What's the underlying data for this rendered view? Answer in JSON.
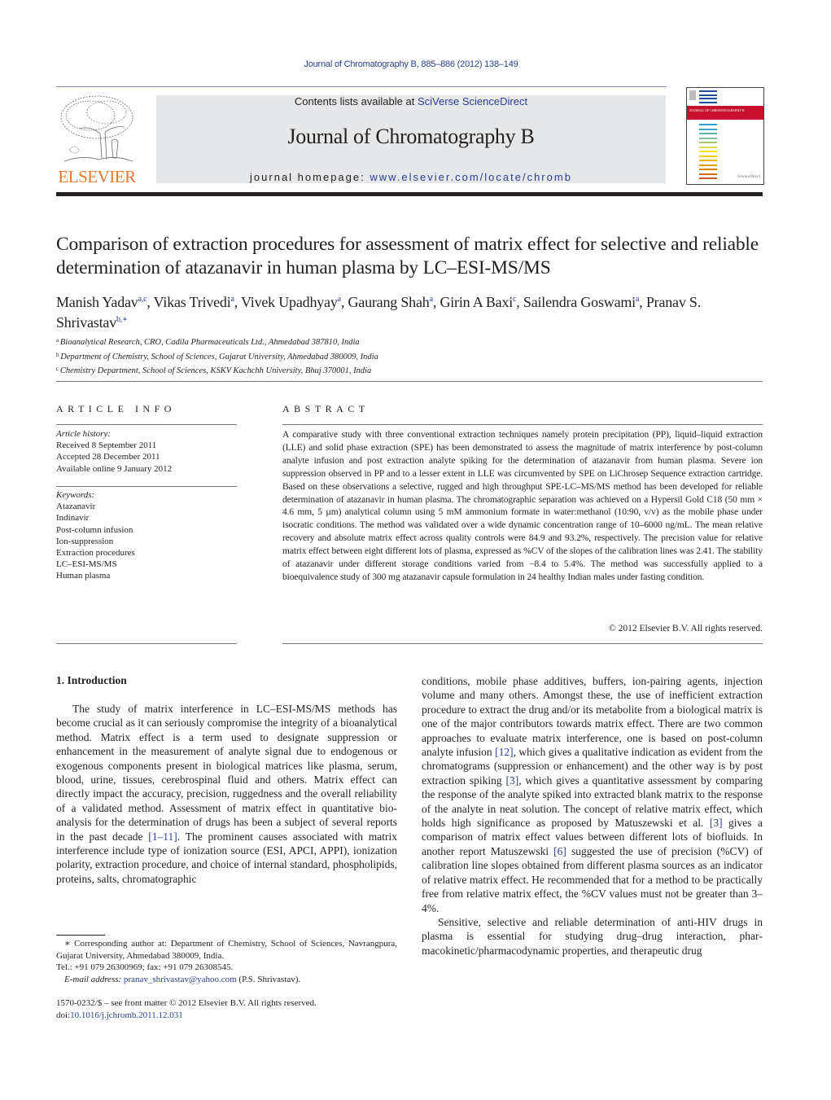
{
  "running_header": "Journal of Chromatography B, 885–886 (2012) 138–149",
  "masthead": {
    "publisher_logo_text": "ELSEVIER",
    "contents_prefix": "Contents lists available at ",
    "contents_link": "SciVerse ScienceDirect",
    "journal_title": "Journal of Chromatography B",
    "homepage_prefix": "journal homepage: ",
    "homepage_link": "www.elsevier.com/locate/chromb",
    "cover_band_text": "JOURNAL OF CHROMATOGRAPHY B",
    "cover_stripe_colors": [
      "#1f4e9c",
      "#1f4e9c",
      "#1f4e9c",
      "#1f4e9c",
      "#2aa0d0",
      "#3aa6c8",
      "#5fb3b3",
      "#7fbf9a",
      "#a6c96a",
      "#d7d84a",
      "#f2e600",
      "#f5d000",
      "#f0b400",
      "#e69a00",
      "#de8000",
      "#d66a10",
      "#cc5a20"
    ]
  },
  "colors": {
    "link": "#2a3f8f",
    "elsevier_orange": "#e8792b",
    "banner_bg": "#e6e7e9",
    "text": "#231f20"
  },
  "article": {
    "title": "Comparison of extraction procedures for assessment of matrix effect for selective and reliable determination of atazanavir in human plasma by LC–ESI-MS/MS",
    "authors": [
      {
        "name": "Manish Yadav",
        "sup": "a,c",
        "sep": ", "
      },
      {
        "name": "Vikas Trivedi",
        "sup": "a",
        "sep": ", "
      },
      {
        "name": "Vivek Upadhyay",
        "sup": "a",
        "sep": ", "
      },
      {
        "name": "Gaurang Shah",
        "sup": "a",
        "sep": ", "
      },
      {
        "name": "Girin A Baxi",
        "sup": "c",
        "sep": ", "
      },
      {
        "name": "Sailendra Goswami",
        "sup": "a",
        "sep": ", "
      },
      {
        "name": "Pranav S. Shrivastav",
        "sup": "b,∗",
        "sep": ""
      }
    ],
    "affiliations": [
      {
        "key": "a",
        "text": "Bioanalytical Research, CRO, Cadila Pharmaceuticals Ltd., Ahmedabad 387810, India"
      },
      {
        "key": "b",
        "text": "Department of Chemistry, School of Sciences, Gujarat University, Ahmedabad 380009, India"
      },
      {
        "key": "c",
        "text": "Chemistry Department, School of Sciences, KSKV Kachchh University, Bhuj 370001, India"
      }
    ]
  },
  "article_info": {
    "heading": "ARTICLE INFO",
    "history_label": "Article history:",
    "history": [
      "Received 8 September 2011",
      "Accepted 28 December 2011",
      "Available online 9 January 2012"
    ],
    "keywords_label": "Keywords:",
    "keywords": [
      "Atazanavir",
      "Indinavir",
      "Post-column infusion",
      "Ion-suppression",
      "Extraction procedures",
      "LC–ESI-MS/MS",
      "Human plasma"
    ]
  },
  "abstract": {
    "heading": "ABSTRACT",
    "text": "A comparative study with three conventional extraction techniques namely protein precipitation (PP), liquid–liquid extraction (LLE) and solid phase extraction (SPE) has been demonstrated to assess the mag­nitude of matrix interference by post-column analyte infusion and post extraction analyte spiking for the determination of atazanavir from human plasma. Severe ion suppression observed in PP and to a lesser extent in LLE was circumvented by SPE on LiChrosep Sequence extraction cartridge. Based on these observations a selective, rugged and high throughput SPE-LC–MS/MS method has been developed for reliable determination of atazanavir in human plasma. The chromatographic separation was achieved on a Hypersil Gold C18 (50 mm × 4.6 mm, 5 µm) analytical column using 5 mM ammonium formate in water:methanol (10:90, v/v) as the mobile phase under isocratic conditions. The method was validated over a wide dynamic concentration range of 10–6000 ng/mL. The mean relative recovery and absolute matrix effect across quality controls were 84.9 and 93.2%, respectively. The precision value for relative matrix effect between eight different lots of plasma, expressed as %CV of the slopes of the calibration lines was 2.41. The stability of atazanavir under different storage conditions varied from −8.4 to 5.4%. The method was successfully applied to a bioequivalence study of 300 mg atazanavir capsule formulation in 24 healthy Indian males under fasting condition.",
    "copyright": "© 2012 Elsevier B.V. All rights reserved."
  },
  "introduction": {
    "heading": "1.  Introduction",
    "left_p1_a": "The study of matrix interference in LC–ESI-MS/MS methods has become crucial as it can seriously compromise the integrity of a bioanalytical method. Matrix effect is a term used to desig­nate suppression or enhancement in the measurement of analyte signal due to endogenous or exogenous components present in biological matrices like plasma, serum, blood, urine, tissues, cere­brospinal fluid and others. Matrix effect can directly impact the accuracy, precision, ruggedness and the overall reliability of a validated method. Assessment of matrix effect in quantitative bio­analysis for the determination of drugs has been a subject of several reports in the past decade ",
    "left_ref_1": "[1–11]",
    "left_p1_b": ". The prominent causes associ­ated with matrix interference include type of ionization source (ESI, APCI, APPI), ionization polarity, extraction procedure, and choice of internal standard, phospholipids, proteins, salts, chromatographic",
    "right_p1_a": "conditions, mobile phase additives, buffers, ion-pairing agents, injection volume and many others. Amongst these, the use of ineffi­cient extraction procedure to extract the drug and/or its metabolite from a biological matrix is one of the major contributors towards matrix effect. There are two common approaches to evaluate matrix interference, one is based on post-column analyte infusion ",
    "right_ref_12": "[12]",
    "right_p1_b": ", which gives a qualitative indication as evident from the chro­matograms (suppression or enhancement) and the other way is by post extraction spiking ",
    "right_ref_3a": "[3]",
    "right_p1_c": ", which gives a quantitative assessment by comparing the response of the analyte spiked into extracted blank matrix to the response of the analyte in neat solution. The concept of relative matrix effect, which holds high significance as proposed by Matuszewski et al. ",
    "right_ref_3b": "[3]",
    "right_p1_d": " gives a comparison of matrix effect values between different lots of biofluids. In another report Matuszewski ",
    "right_ref_6": "[6]",
    "right_p1_e": " suggested the use of precision (%CV) of calibration line slopes obtained from different plasma sources as an indicator of relative matrix effect. He recommended that for a method to be practically free from relative matrix effect, the %CV values must not be greater than 3–4%.",
    "right_p2": "Sensitive, selective and reliable determination of anti-HIV drugs in plasma is essential for studying drug–drug interaction, phar­macokinetic/pharmacodynamic properties, and therapeutic drug"
  },
  "footnote": {
    "corresponding": "∗ Corresponding author at: Department of Chemistry, School of Sciences, Navrangpura, Gujarat University, Ahmedabad 380009, India.",
    "tel": "Tel.: +91 079 26300969; fax: +91 079 26308545.",
    "email_label": "E-mail address: ",
    "email": "pranav_shrivastav@yahoo.com",
    "email_suffix": " (P.S. Shrivastav)."
  },
  "front_matter": {
    "issn_line": "1570-0232/$ – see front matter © 2012 Elsevier B.V. All rights reserved.",
    "doi_prefix": "doi:",
    "doi": "10.1016/j.jchromb.2011.12.031"
  }
}
